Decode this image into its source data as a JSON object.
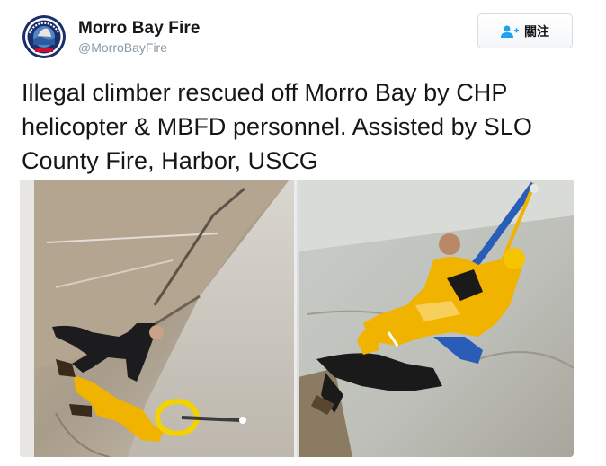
{
  "tweet": {
    "author": {
      "display_name": "Morro Bay Fire",
      "handle": "@MorroBayFire",
      "avatar_text": "MORRO BAY"
    },
    "follow_button": {
      "label": "關注",
      "icon": "add-user-icon"
    },
    "text": "Illegal climber rescued off Morro Bay by CHP helicopter & MBFD personnel. Assisted by SLO County Fire, Harbor, USCG",
    "media": [
      {
        "description_icon": "photo-climber-on-rock"
      },
      {
        "description_icon": "photo-rescue-hoist"
      }
    ]
  },
  "colors": {
    "primary_text": "#14171a",
    "secondary_text": "#8899a6",
    "rescuer_yellow": "#f0b200",
    "rock": "#b9b3a8"
  }
}
